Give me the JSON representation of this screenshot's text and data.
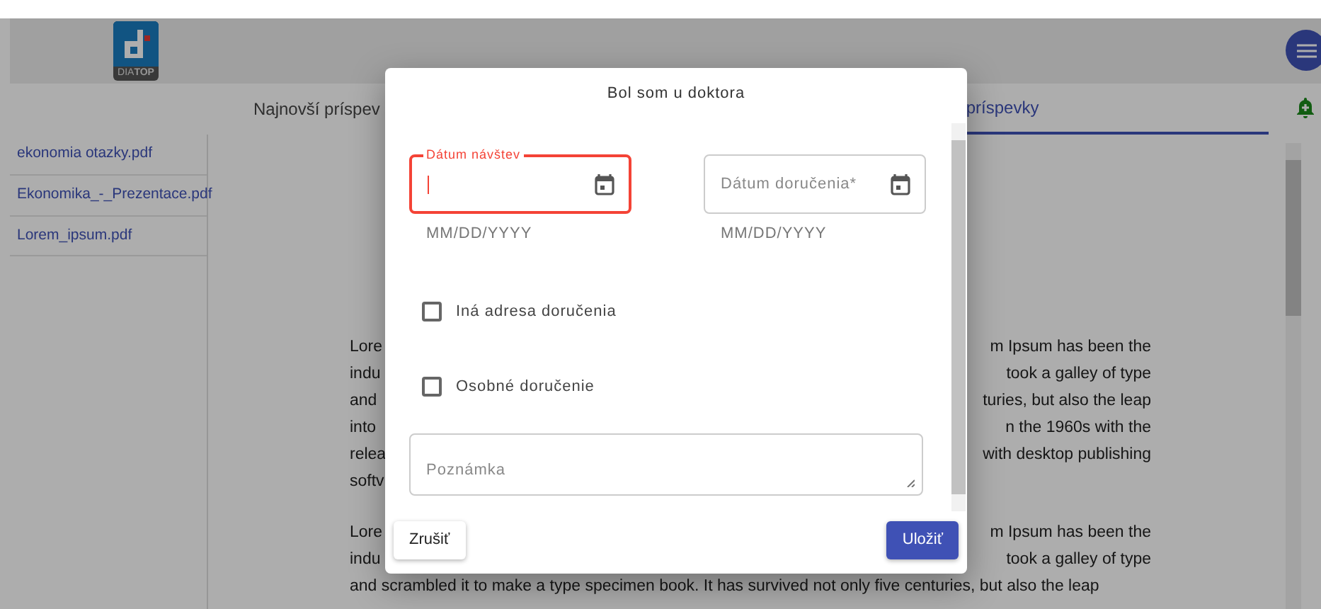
{
  "header": {
    "logo_text": "DIA**TOP**"
  },
  "tabs": [
    {
      "label": "Najnovší príspev",
      "selected": false
    },
    {
      "label": "príspevky",
      "selected": true
    }
  ],
  "files": [
    "ekonomia otazky.pdf",
    "Ekonomika_-_Prezentace.pdf",
    "Lorem_ipsum.pdf"
  ],
  "article": {
    "paragraphs": [
      {
        "lines": [
          {
            "left": "Lore",
            "right": "m Ipsum has been the"
          },
          {
            "left": "indu",
            "right": "took a galley of type"
          },
          {
            "left": "and",
            "right": "turies, but also the leap"
          },
          {
            "left": "into",
            "right": "n the 1960s with the"
          },
          {
            "left": "relea",
            "right": "with desktop publishing"
          },
          {
            "left": "softv"
          }
        ]
      },
      {
        "lines": [
          {
            "left": "Lore",
            "right": "m Ipsum has been the"
          },
          {
            "left": "indu",
            "right": "took a galley of type"
          },
          {
            "left": "and scrambled it to make a type specimen book. It has survived not only five centuries, but also the leap"
          }
        ]
      }
    ]
  },
  "dialog": {
    "title": "Bol som u doktora",
    "fields": [
      {
        "kind": "date",
        "label": "Dátum návštev",
        "error": true,
        "focused": true,
        "hint": "MM/DD/YYYY"
      },
      {
        "kind": "date",
        "label": "Dátum doručenia*",
        "error": false,
        "focused": false,
        "hint": "MM/DD/YYYY"
      }
    ],
    "checkboxes": [
      {
        "label": "Iná adresa doručenia",
        "checked": false
      },
      {
        "label": "Osobné doručenie",
        "checked": false
      }
    ],
    "note": {
      "placeholder": "Poznámka"
    },
    "buttons": [
      {
        "label": "Zrušiť",
        "kind": "secondary"
      },
      {
        "label": "Uložiť",
        "kind": "primary"
      }
    ]
  }
}
